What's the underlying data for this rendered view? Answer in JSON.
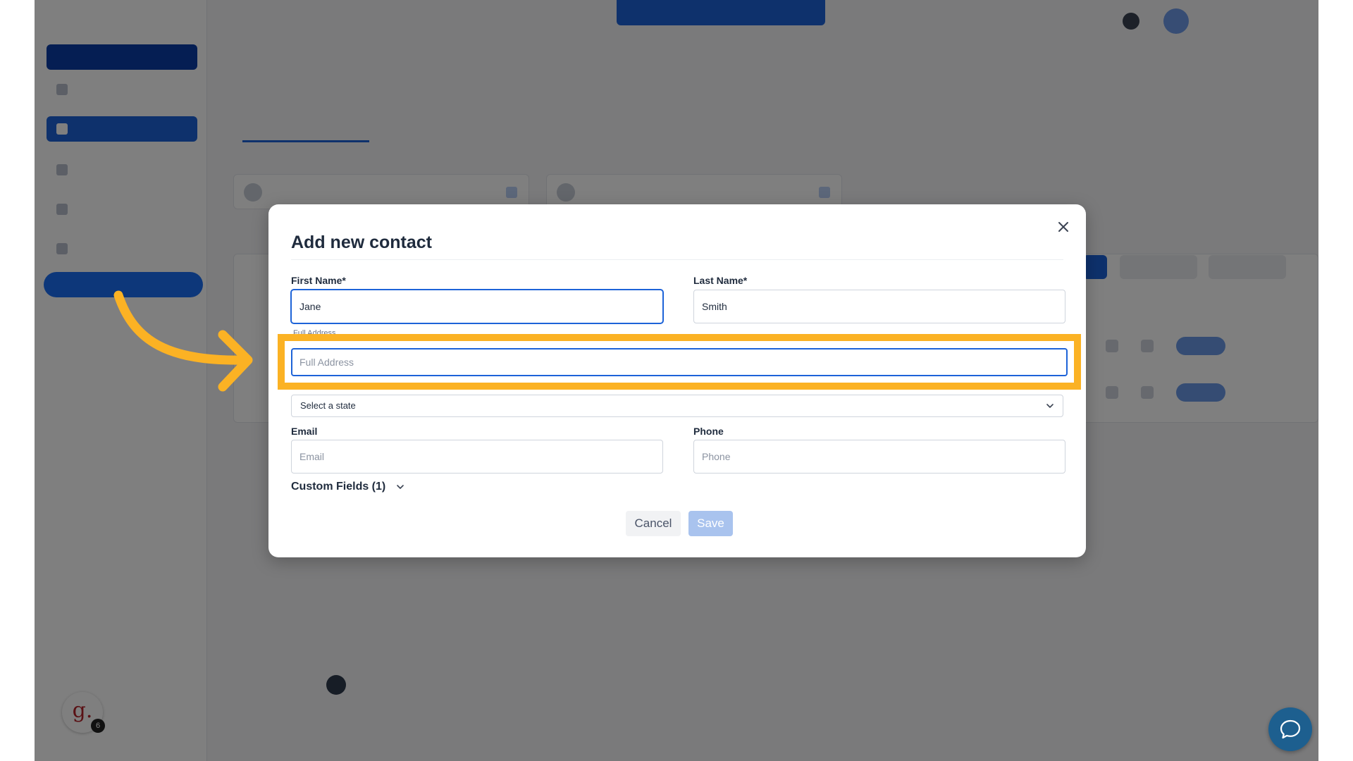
{
  "background": {
    "topbar_button": "",
    "user_name": "",
    "user_sub": "",
    "logo_main": "",
    "logo_sub": "",
    "sidebar": {
      "top_button": "",
      "items": [
        {
          "label": ""
        },
        {
          "label": ""
        },
        {
          "label": ""
        },
        {
          "label": ""
        },
        {
          "label": ""
        }
      ],
      "cta": ""
    },
    "page_title": "",
    "tabs": [
      "",
      ""
    ],
    "sections": [
      "",
      ""
    ],
    "cards": [
      "",
      ""
    ],
    "avatar_letter": "g.",
    "avatar_badge": "6",
    "footer_logo": ""
  },
  "modal": {
    "title": "Add new contact",
    "first_name": {
      "label": "First Name*",
      "value": "Jane"
    },
    "last_name": {
      "label": "Last Name*",
      "value": "Smith"
    },
    "full_address": {
      "label": "Full Address",
      "placeholder": "Full Address",
      "value": ""
    },
    "state": {
      "selected": "Select a state"
    },
    "email": {
      "label": "Email",
      "placeholder": "Email"
    },
    "phone": {
      "label": "Phone",
      "placeholder": "Phone"
    },
    "custom_fields": "Custom Fields (1)",
    "cancel": "Cancel",
    "save": "Save"
  },
  "icons": {
    "close": "close-icon",
    "chevron": "chevron-down-icon",
    "chat": "chat-bubble-icon",
    "arrow": "pointer-arrow-icon"
  },
  "colors": {
    "primary": "#1d63d8",
    "highlight": "#fbb224",
    "save_disabled": "#a9c3ee"
  }
}
